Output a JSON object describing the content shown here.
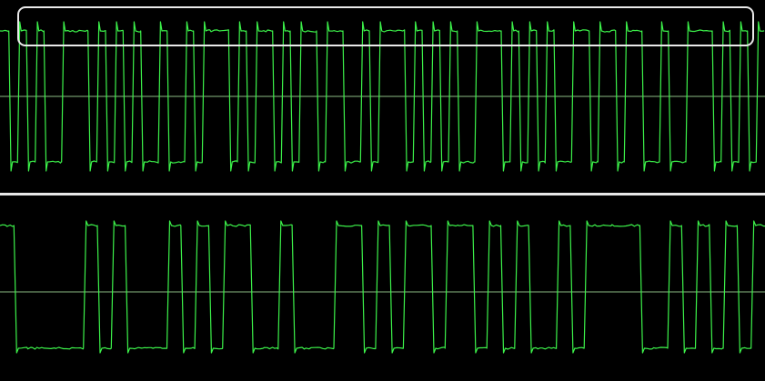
{
  "colors": {
    "background": "#000000",
    "trace": "#3cf24a",
    "reference_line": "#8bbd83",
    "divider": "#e8e8e8",
    "highlight_border": "#e9e9e9"
  },
  "channels": [
    {
      "id": "ch1",
      "bits": [
        1,
        0,
        1,
        0,
        1,
        0,
        0,
        1,
        1,
        1,
        0,
        1,
        0,
        1,
        0,
        1,
        0,
        0,
        1,
        0,
        0,
        1,
        0,
        1,
        1,
        1,
        0,
        1,
        0,
        1,
        1,
        0,
        1,
        0,
        1,
        1,
        0,
        1,
        1,
        0,
        0,
        1,
        0,
        1,
        1,
        1,
        0,
        1,
        0,
        1,
        0,
        1,
        0,
        0,
        1,
        1,
        1,
        0,
        1,
        0,
        1,
        0,
        1,
        0,
        0,
        1,
        1,
        0,
        1,
        1,
        0,
        1,
        1,
        0,
        0,
        1,
        0,
        0,
        1,
        1,
        1,
        0,
        1,
        0,
        1,
        0,
        1
      ]
    },
    {
      "id": "ch2",
      "bits": [
        1,
        0,
        0,
        0,
        0,
        0,
        1,
        0,
        1,
        0,
        0,
        0,
        1,
        0,
        1,
        0,
        1,
        1,
        0,
        0,
        1,
        0,
        0,
        0,
        1,
        1,
        0,
        1,
        0,
        1,
        1,
        0,
        1,
        1,
        0,
        1,
        0,
        1,
        0,
        0,
        1,
        0,
        1,
        1,
        1,
        1,
        0,
        0,
        1,
        0,
        1,
        0,
        1,
        0,
        1
      ]
    }
  ],
  "highlight": {
    "visible": true
  }
}
